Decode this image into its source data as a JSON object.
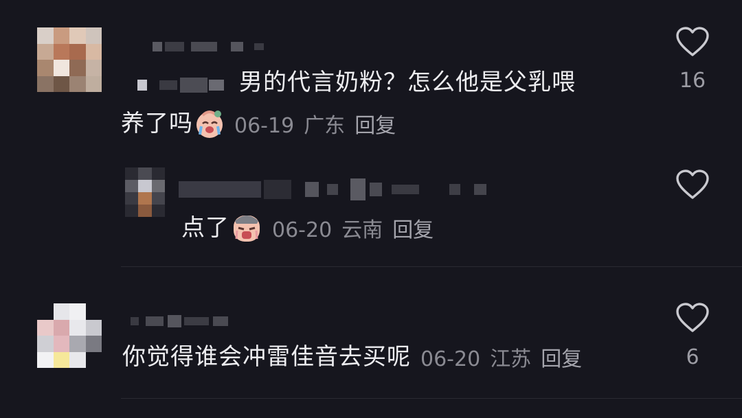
{
  "comments": [
    {
      "text_line1": "男的代言奶粉？怎么他是父乳喂",
      "text_line2": "养了吗",
      "emoji": "crying-baby-emoji",
      "date": "06-19",
      "location": "广东",
      "reply_label": "回复",
      "likes": "16"
    },
    {
      "text": "点了",
      "emoji": "crying-face-emoji",
      "date": "06-20",
      "location": "云南",
      "reply_label": "回复"
    },
    {
      "text": "你觉得谁会冲雷佳音去买呢",
      "date": "06-20",
      "location": "江苏",
      "reply_label": "回复",
      "likes": "6"
    }
  ],
  "icons": {
    "like": "heart-outline-icon"
  },
  "colors": {
    "background": "#16161e",
    "text": "#ededf0",
    "meta": "#8a8a92"
  }
}
